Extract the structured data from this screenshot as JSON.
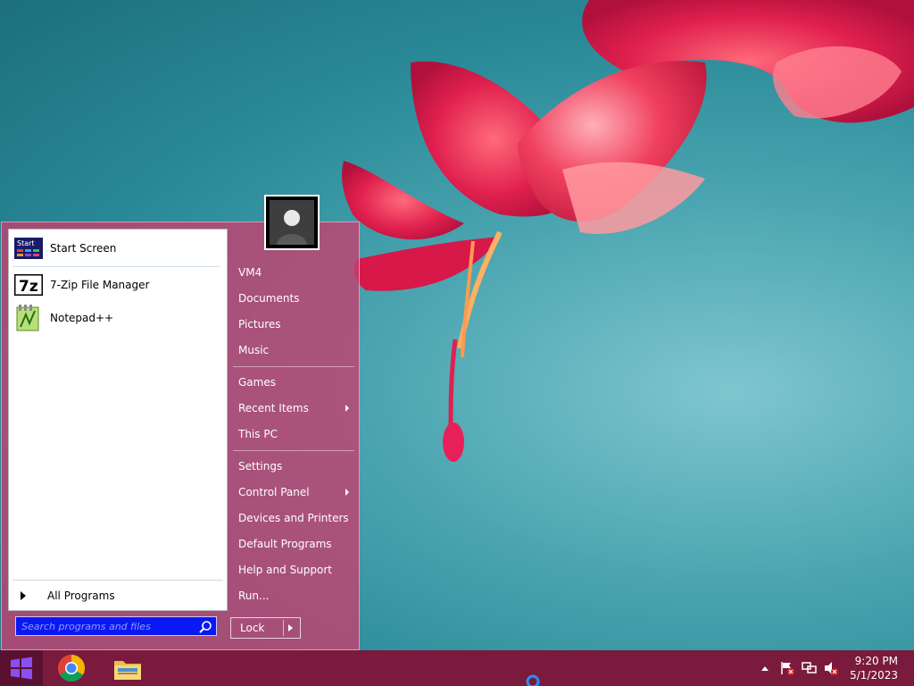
{
  "start_menu": {
    "pinned": [
      {
        "label": "Start Screen",
        "icon": "start-screen-icon"
      },
      {
        "label": "7-Zip File Manager",
        "icon": "7zip-icon"
      },
      {
        "label": "Notepad++",
        "icon": "notepadpp-icon"
      }
    ],
    "start_icon_text": "Start",
    "sevenzip_icon_text": "7z",
    "all_programs_label": "All Programs",
    "search_placeholder": "Search programs and files",
    "right_items": [
      {
        "label": "VM4"
      },
      {
        "label": "Documents"
      },
      {
        "label": "Pictures"
      },
      {
        "label": "Music"
      },
      {
        "label": "Games"
      },
      {
        "label": "Recent Items",
        "submenu": true
      },
      {
        "label": "This PC"
      },
      {
        "label": "Settings"
      },
      {
        "label": "Control Panel",
        "submenu": true
      },
      {
        "label": "Devices and Printers"
      },
      {
        "label": "Default Programs"
      },
      {
        "label": "Help and Support"
      },
      {
        "label": "Run..."
      }
    ],
    "power_button_label": "Lock"
  },
  "taskbar": {
    "pinned_apps": [
      {
        "name": "Google Chrome",
        "icon": "chrome-icon"
      },
      {
        "name": "File Explorer",
        "icon": "folder-icon"
      }
    ],
    "tray_icons": [
      "show-hidden-icons",
      "action-center-flag-icon",
      "network-icon",
      "volume-muted-icon"
    ],
    "clock": {
      "time": "9:20 PM",
      "date": "5/1/2023"
    }
  },
  "colors": {
    "menu_accent": "#c44070",
    "taskbar": "#7a1a3c",
    "search_field": "#0a18f2",
    "wallpaper": "#2a8a98"
  }
}
